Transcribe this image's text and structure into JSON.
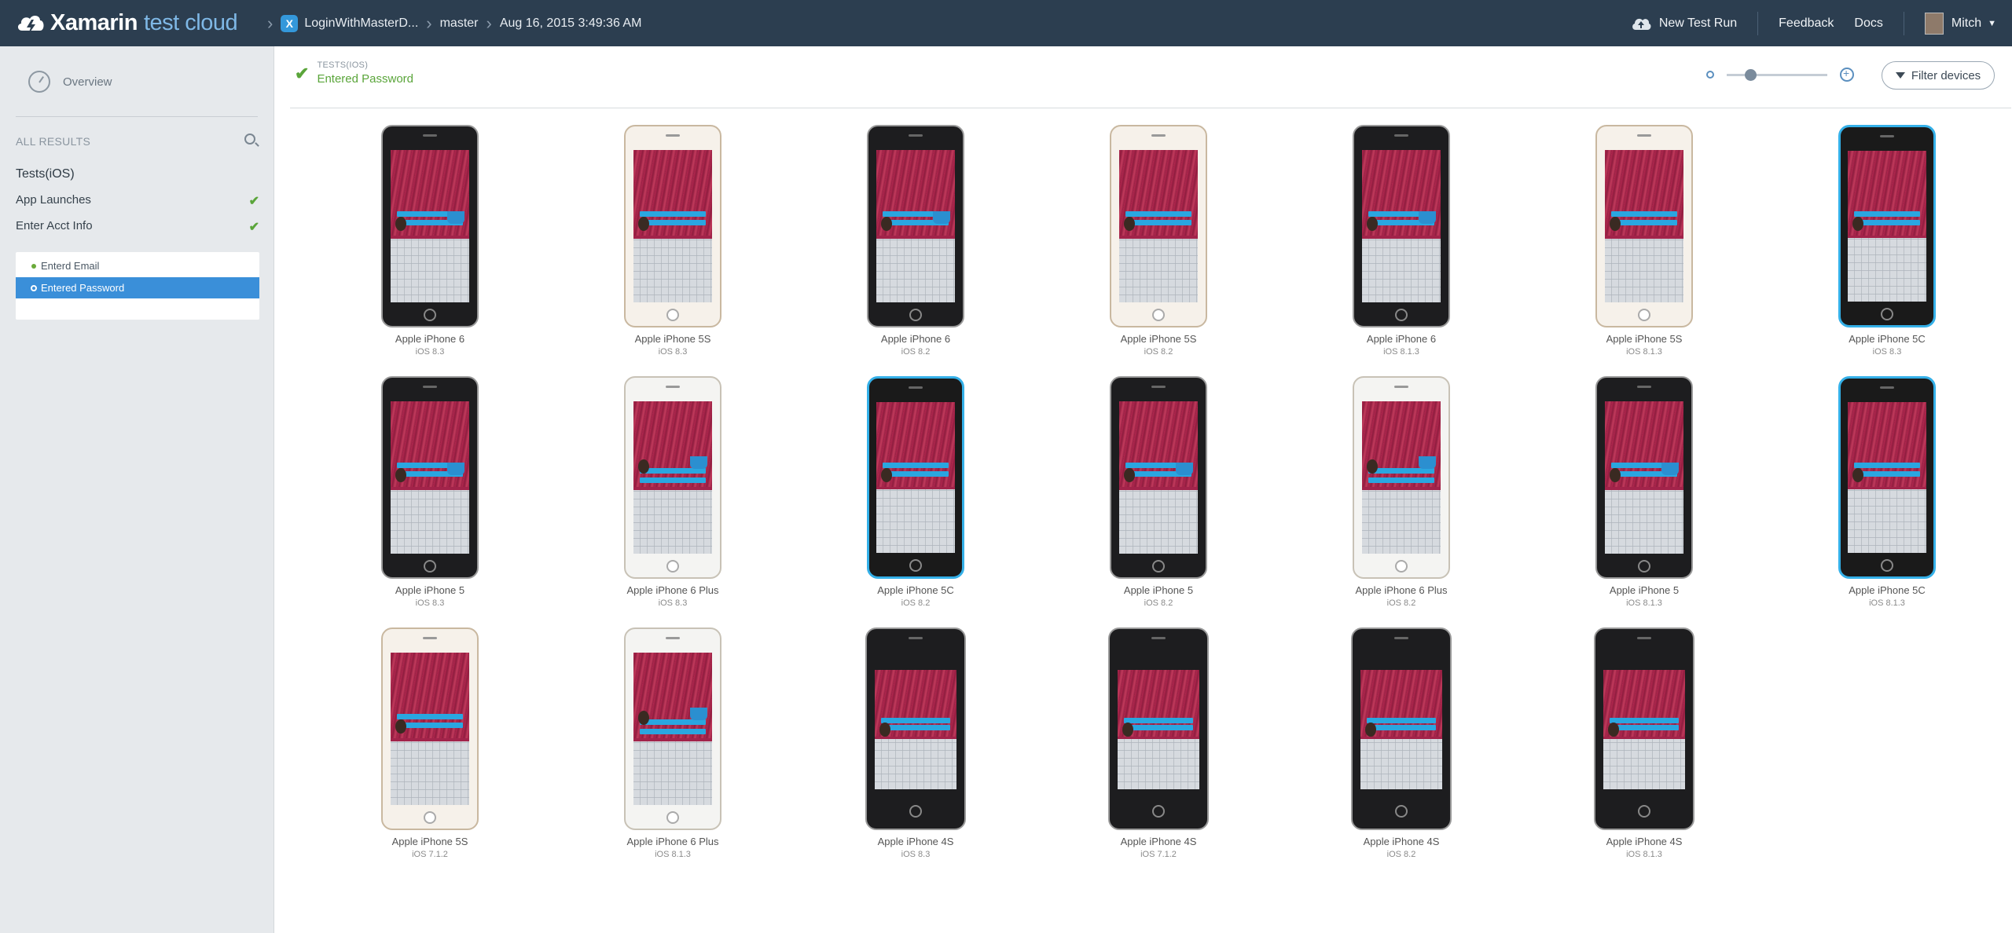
{
  "header": {
    "brand_bold": "Xamarin",
    "brand_light": "test cloud",
    "app_name": "LoginWithMasterD...",
    "app_icon_letter": "X",
    "branch": "master",
    "run_date": "Aug 16, 2015 3:49:36 AM",
    "new_test_run": "New Test Run",
    "feedback": "Feedback",
    "docs": "Docs",
    "user": "Mitch"
  },
  "sidebar": {
    "overview": "Overview",
    "all_results": "ALL RESULTS",
    "tests": "Tests(iOS)",
    "items": [
      {
        "label": "App Launches",
        "status": "✔"
      },
      {
        "label": "Enter Acct Info",
        "status": "✔"
      }
    ],
    "steps": [
      {
        "label": "Enterd Email",
        "selected": false
      },
      {
        "label": "Entered Password",
        "selected": true
      }
    ]
  },
  "main": {
    "crumb": "TESTS(IOS)",
    "title": "Entered Password",
    "filter_label": "Filter devices",
    "zoom_level": 0.2
  },
  "devices": [
    {
      "name": "Apple iPhone 6",
      "os": "iOS 8.3",
      "color": "dark"
    },
    {
      "name": "Apple iPhone 5S",
      "os": "iOS 8.3",
      "color": "gold"
    },
    {
      "name": "Apple iPhone 6",
      "os": "iOS 8.2",
      "color": "dark"
    },
    {
      "name": "Apple iPhone 5S",
      "os": "iOS 8.2",
      "color": "gold"
    },
    {
      "name": "Apple iPhone 6",
      "os": "iOS 8.1.3",
      "color": "dark"
    },
    {
      "name": "Apple iPhone 5S",
      "os": "iOS 8.1.3",
      "color": "gold"
    },
    {
      "name": "Apple iPhone 5C",
      "os": "iOS 8.3",
      "color": "blue"
    },
    {
      "name": "Apple iPhone 5",
      "os": "iOS 8.3",
      "color": "dark"
    },
    {
      "name": "Apple iPhone 6 Plus",
      "os": "iOS 8.3",
      "color": "silver"
    },
    {
      "name": "Apple iPhone 5C",
      "os": "iOS 8.2",
      "color": "blue"
    },
    {
      "name": "Apple iPhone 5",
      "os": "iOS 8.2",
      "color": "dark"
    },
    {
      "name": "Apple iPhone 6 Plus",
      "os": "iOS 8.2",
      "color": "silver"
    },
    {
      "name": "Apple iPhone 5",
      "os": "iOS 8.1.3",
      "color": "dark"
    },
    {
      "name": "Apple iPhone 5C",
      "os": "iOS 8.1.3",
      "color": "blue"
    },
    {
      "name": "Apple iPhone 5S",
      "os": "iOS 7.1.2",
      "color": "gold"
    },
    {
      "name": "Apple iPhone 6 Plus",
      "os": "iOS 8.1.3",
      "color": "silver"
    },
    {
      "name": "Apple iPhone 4S",
      "os": "iOS 8.3",
      "color": "dark"
    },
    {
      "name": "Apple iPhone 4S",
      "os": "iOS 7.1.2",
      "color": "dark"
    },
    {
      "name": "Apple iPhone 4S",
      "os": "iOS 8.2",
      "color": "dark"
    },
    {
      "name": "Apple iPhone 4S",
      "os": "iOS 8.1.3",
      "color": "dark"
    }
  ]
}
